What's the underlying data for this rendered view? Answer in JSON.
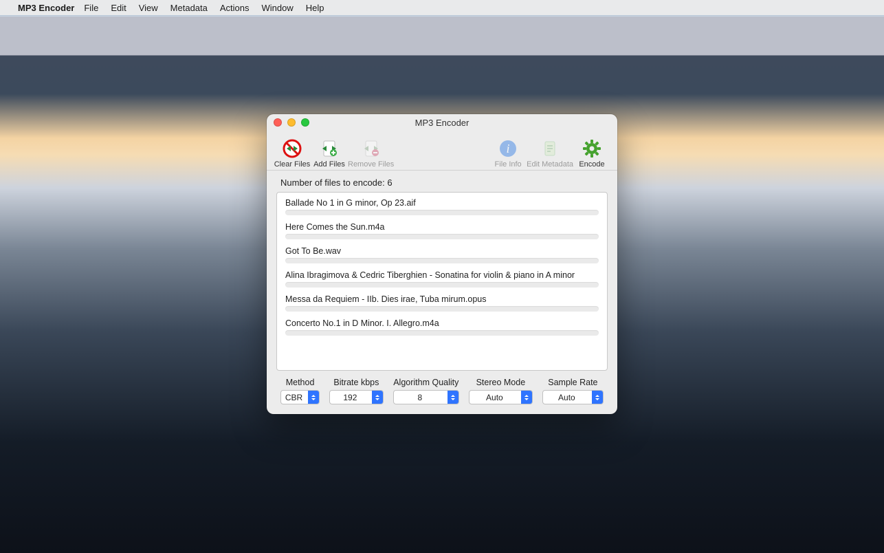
{
  "menubar": {
    "app_name": "MP3 Encoder",
    "items": [
      "File",
      "Edit",
      "View",
      "Metadata",
      "Actions",
      "Window",
      "Help"
    ]
  },
  "window": {
    "title": "MP3 Encoder"
  },
  "toolbar": {
    "clear_files": "Clear Files",
    "add_files": "Add Files",
    "remove_files": "Remove Files",
    "file_info": "File Info",
    "edit_metadata": "Edit Metadata",
    "encode": "Encode"
  },
  "file_count_label": "Number of files to encode: 6",
  "files": [
    "Ballade No 1 in G minor, Op 23.aif",
    "Here Comes the Sun.m4a",
    "Got To Be.wav",
    "Alina Ibragimova & Cedric Tiberghien - Sonatina for violin & piano in A minor",
    "Messa da Requiem - IIb. Dies irae, Tuba mirum.opus",
    "Concerto No.1 in D Minor. I. Allegro.m4a"
  ],
  "controls": {
    "method": {
      "label": "Method",
      "value": "CBR"
    },
    "bitrate": {
      "label": "Bitrate kbps",
      "value": "192"
    },
    "quality": {
      "label": "Algorithm Quality",
      "value": "8"
    },
    "stereo": {
      "label": "Stereo Mode",
      "value": "Auto"
    },
    "sample_rate": {
      "label": "Sample Rate",
      "value": "Auto"
    }
  }
}
